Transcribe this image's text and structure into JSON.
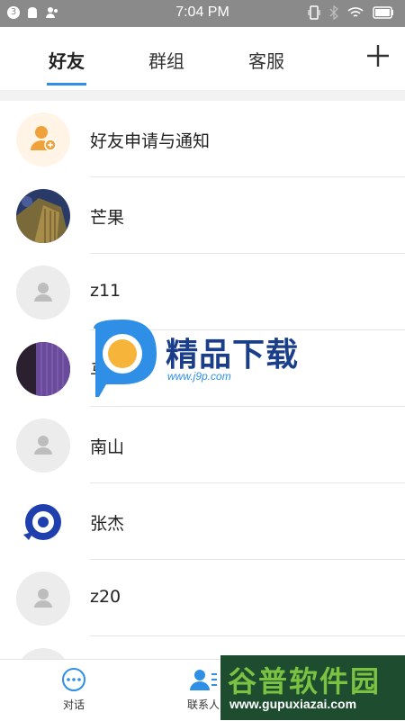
{
  "status": {
    "time": "7:04 PM",
    "badge": "3"
  },
  "tabs": [
    {
      "label": "好友"
    },
    {
      "label": "群组"
    },
    {
      "label": "客服"
    }
  ],
  "contacts": [
    {
      "name": "好友申请与通知",
      "avatar": "friend-request-icon"
    },
    {
      "name": "芒果",
      "avatar": "photo"
    },
    {
      "name": "z11",
      "avatar": "default-person-icon"
    },
    {
      "name": "马格",
      "avatar": "photo"
    },
    {
      "name": "南山",
      "avatar": "default-person-icon"
    },
    {
      "name": "张杰",
      "avatar": "chat-logo-icon"
    },
    {
      "name": "z20",
      "avatar": "default-person-icon"
    }
  ],
  "bottom_nav": [
    {
      "label": "对话"
    },
    {
      "label": "联系人"
    }
  ],
  "watermarks": {
    "top_title": "精品下载",
    "top_url": "www.j9p.com",
    "bottom_title": "谷普软件园",
    "bottom_url": "www.gupuxiazai.com"
  },
  "colors": {
    "accent": "#2f8fe6",
    "orange": "#f0a23a"
  }
}
